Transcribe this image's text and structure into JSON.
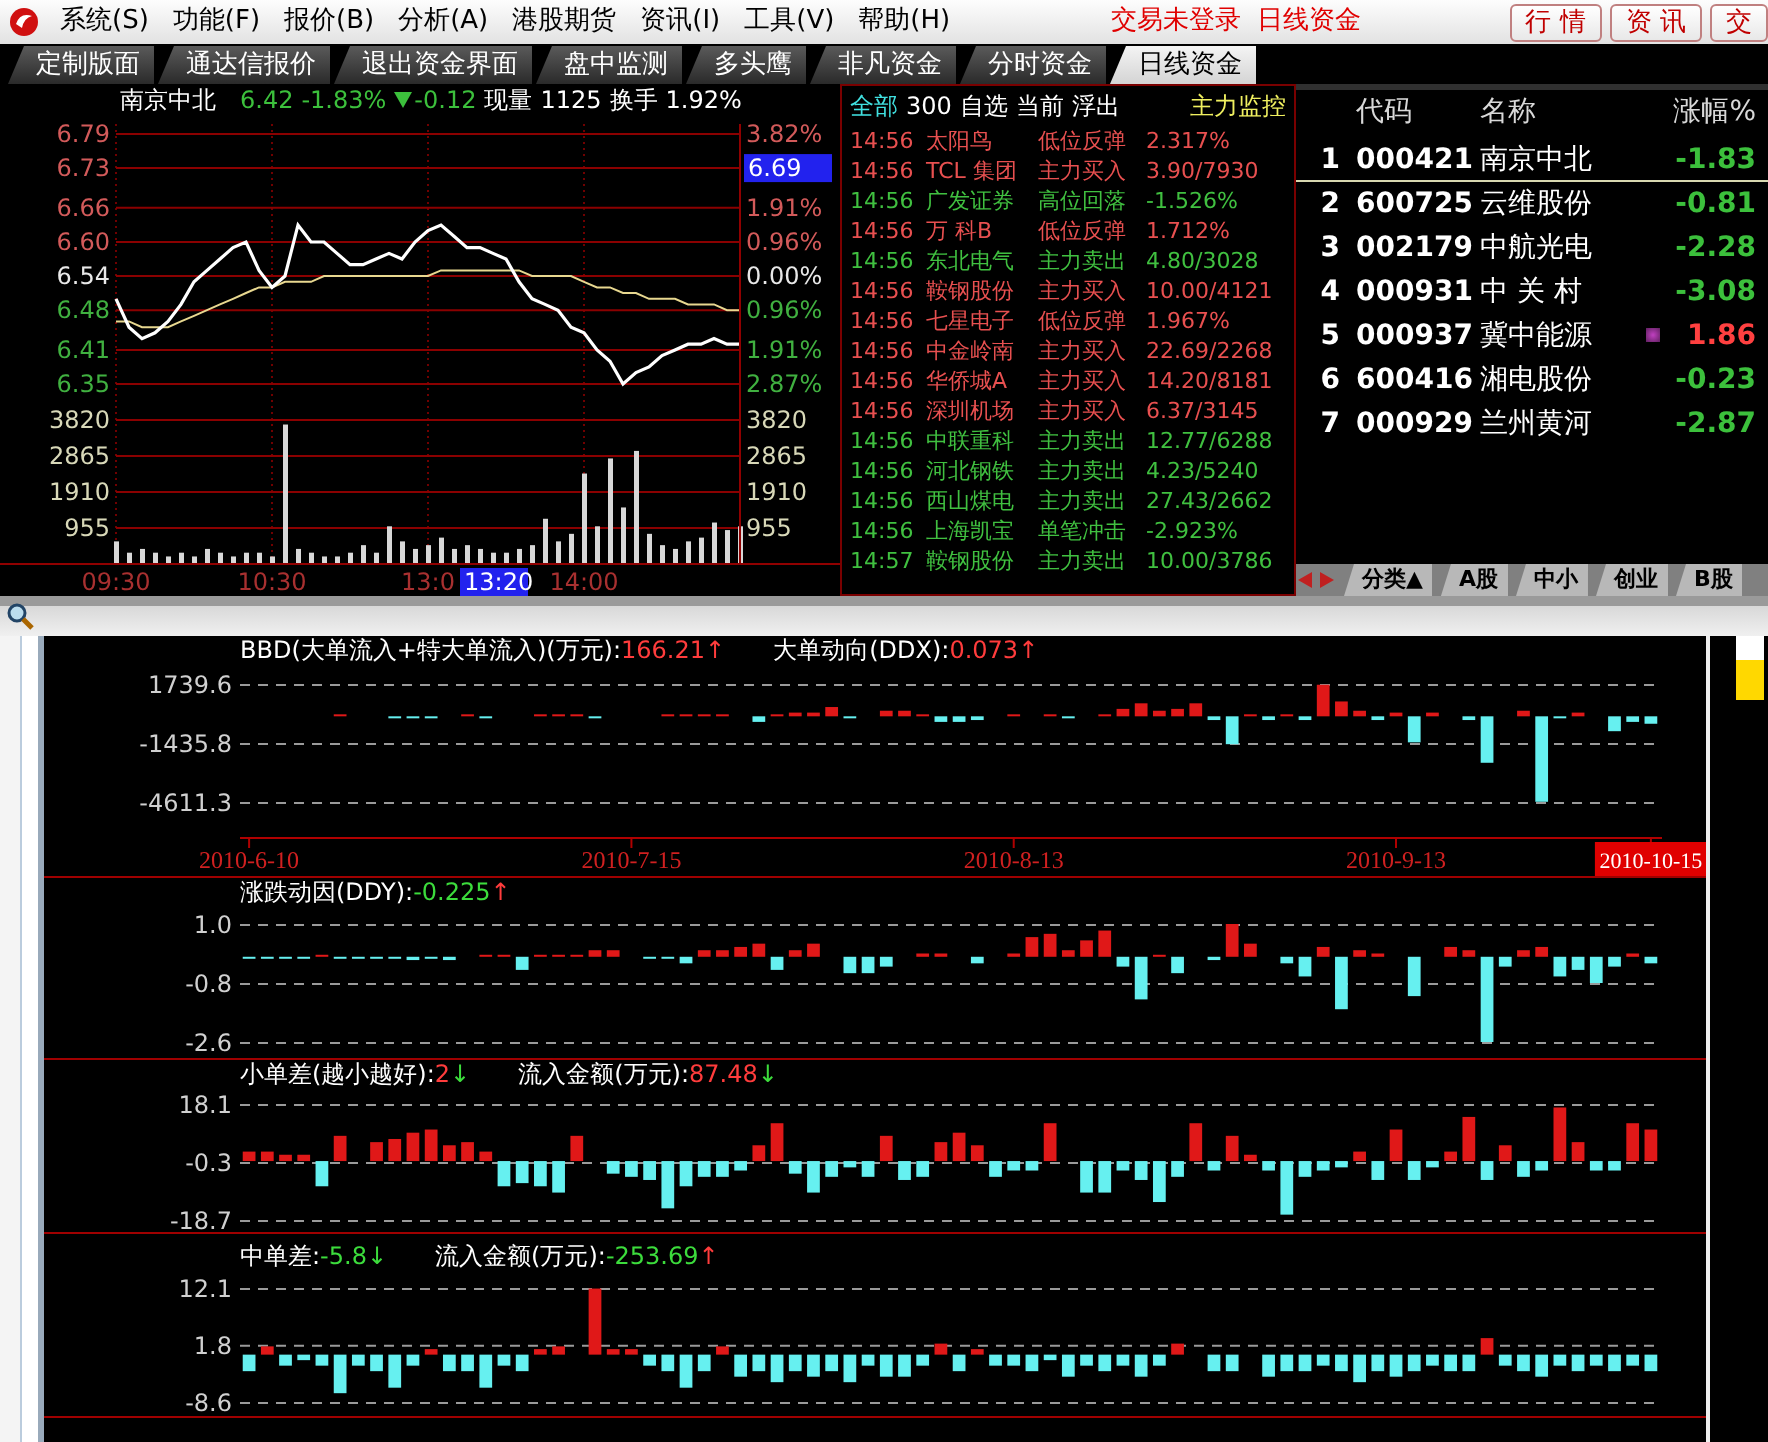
{
  "menu_bar": {
    "items": [
      "系统(S)",
      "功能(F)",
      "报价(B)",
      "分析(A)",
      "港股期货",
      "资讯(I)",
      "工具(V)",
      "帮助(H)"
    ],
    "status": [
      "交易未登录",
      "日线资金"
    ],
    "buttons": [
      "行 情",
      "资 讯",
      "交"
    ]
  },
  "tabs": [
    {
      "label": "定制版面",
      "selected": false
    },
    {
      "label": "通达信报价",
      "selected": false
    },
    {
      "label": "退出资金界面",
      "selected": false
    },
    {
      "label": "盘中监测",
      "selected": false
    },
    {
      "label": "多头鹰",
      "selected": false
    },
    {
      "label": "非凡资金",
      "selected": false
    },
    {
      "label": "分时资金",
      "selected": false
    },
    {
      "label": "日线资金",
      "selected": true
    }
  ],
  "intraday": {
    "header": {
      "name": "南京中北",
      "price": "6.42",
      "change_pct": "-1.83%",
      "change": "-0.12",
      "volume_label": "现量",
      "volume": "1125",
      "turnover_label": "换手",
      "turnover": "1.92%"
    },
    "chart_data": {
      "type": "line",
      "grid": true,
      "ylim": [
        6.35,
        6.79
      ],
      "yticks": [
        {
          "value": 6.79,
          "label": "6.79"
        },
        {
          "value": 6.73,
          "label": "6.73"
        },
        {
          "value": 6.66,
          "label": "6.66"
        },
        {
          "value": 6.6,
          "label": "6.60"
        },
        {
          "value": 6.54,
          "label": "6.54"
        },
        {
          "value": 6.48,
          "label": "6.48"
        },
        {
          "value": 6.41,
          "label": "6.41"
        },
        {
          "value": 6.35,
          "label": "6.35"
        }
      ],
      "series": [
        {
          "color": "#ffffff",
          "values": [
            6.5,
            6.45,
            6.43,
            6.44,
            6.46,
            6.49,
            6.53,
            6.55,
            6.57,
            6.59,
            6.6,
            6.55,
            6.52,
            6.54,
            6.63,
            6.6,
            6.6,
            6.58,
            6.56,
            6.56,
            6.57,
            6.58,
            6.57,
            6.6,
            6.62,
            6.63,
            6.61,
            6.59,
            6.59,
            6.58,
            6.57,
            6.53,
            6.5,
            6.49,
            6.48,
            6.45,
            6.44,
            6.41,
            6.39,
            6.35,
            6.37,
            6.38,
            6.4,
            6.41,
            6.42,
            6.42,
            6.43,
            6.42,
            6.42
          ]
        },
        {
          "color": "#e8d890",
          "values": [
            6.46,
            6.46,
            6.45,
            6.45,
            6.45,
            6.46,
            6.47,
            6.48,
            6.49,
            6.5,
            6.51,
            6.52,
            6.52,
            6.53,
            6.53,
            6.53,
            6.54,
            6.54,
            6.54,
            6.54,
            6.54,
            6.54,
            6.54,
            6.54,
            6.54,
            6.55,
            6.55,
            6.55,
            6.55,
            6.55,
            6.55,
            6.55,
            6.54,
            6.54,
            6.54,
            6.54,
            6.53,
            6.52,
            6.52,
            6.51,
            6.51,
            6.5,
            6.5,
            6.5,
            6.49,
            6.49,
            6.49,
            6.48,
            6.48
          ]
        }
      ]
    },
    "right_ticks": [
      {
        "label": "3.82%",
        "kind": "up"
      },
      {
        "label": "6.69",
        "kind": "cursor"
      },
      {
        "label": "1.91%",
        "kind": "up"
      },
      {
        "label": "0.96%",
        "kind": "up"
      },
      {
        "label": "0.00%",
        "kind": "flat"
      },
      {
        "label": "0.96%",
        "kind": "down"
      },
      {
        "label": "1.91%",
        "kind": "down"
      },
      {
        "label": "2.87%",
        "kind": "down"
      }
    ],
    "volume": {
      "chart_data": {
        "type": "bar",
        "grid": true,
        "ylim": [
          0,
          3820
        ],
        "categories": [
          "09:30",
          null,
          null,
          null,
          null,
          null,
          null,
          null,
          null,
          null,
          null,
          null,
          "10:30",
          null,
          null,
          null,
          null,
          null,
          null,
          null,
          null,
          null,
          null,
          null,
          "13:0",
          null,
          null,
          null,
          null,
          null,
          null,
          null,
          null,
          null,
          null,
          null,
          "14:00",
          null,
          null,
          null,
          null,
          null,
          null,
          null,
          null,
          null,
          null,
          null,
          null
        ],
        "yticks": [
          {
            "value": 3820,
            "label": "3820"
          },
          {
            "value": 2865,
            "label": "2865"
          },
          {
            "value": 1910,
            "label": "1910"
          },
          {
            "value": 955,
            "label": "955"
          }
        ],
        "series": [
          {
            "color": "#d8d8d8",
            "values": [
              600,
              300,
              400,
              300,
              200,
              300,
              200,
              400,
              300,
              200,
              300,
              300,
              200,
              3700,
              400,
              300,
              200,
              200,
              300,
              500,
              300,
              1000,
              600,
              400,
              500,
              700,
              400,
              500,
              400,
              300,
              300,
              400,
              500,
              1200,
              600,
              800,
              2400,
              1000,
              2800,
              1500,
              3000,
              800,
              500,
              400,
              600,
              700,
              1100,
              900,
              1000
            ]
          }
        ]
      },
      "right_ticks": [
        "3820",
        "2865",
        "1910",
        "955"
      ]
    },
    "time_cursor": "13:20"
  },
  "monitor": {
    "filters": [
      {
        "label": "全部",
        "selected": true
      },
      {
        "label": "300",
        "selected": false
      },
      {
        "label": "自选",
        "selected": false
      },
      {
        "label": "当前",
        "selected": false
      },
      {
        "label": "浮出",
        "selected": false
      }
    ],
    "title": "主力监控",
    "rows": [
      {
        "time": "14:56",
        "name": "太阳鸟",
        "signal": "低位反弹",
        "value": "2.317%",
        "color": "#e85050"
      },
      {
        "time": "14:56",
        "name": "TCL 集团",
        "signal": "主力买入",
        "value": "3.90/7930",
        "color": "#e85050"
      },
      {
        "time": "14:56",
        "name": "广发证券",
        "signal": "高位回落",
        "value": "-1.526%",
        "color": "#40c040"
      },
      {
        "time": "14:56",
        "name": "万 科B",
        "signal": "低位反弹",
        "value": "1.712%",
        "color": "#e85050"
      },
      {
        "time": "14:56",
        "name": "东北电气",
        "signal": "主力卖出",
        "value": "4.80/3028",
        "color": "#40c040"
      },
      {
        "time": "14:56",
        "name": "鞍钢股份",
        "signal": "主力买入",
        "value": "10.00/4121",
        "color": "#e85050"
      },
      {
        "time": "14:56",
        "name": "七星电子",
        "signal": "低位反弹",
        "value": "1.967%",
        "color": "#e85050"
      },
      {
        "time": "14:56",
        "name": "中金岭南",
        "signal": "主力买入",
        "value": "22.69/2268",
        "color": "#e85050"
      },
      {
        "time": "14:56",
        "name": "华侨城A",
        "signal": "主力买入",
        "value": "14.20/8181",
        "color": "#e85050"
      },
      {
        "time": "14:56",
        "name": "深圳机场",
        "signal": "主力买入",
        "value": "6.37/3145",
        "color": "#e85050"
      },
      {
        "time": "14:56",
        "name": "中联重科",
        "signal": "主力卖出",
        "value": "12.77/6288",
        "color": "#40c040"
      },
      {
        "time": "14:56",
        "name": "河北钢铁",
        "signal": "主力卖出",
        "value": "4.23/5240",
        "color": "#40c040"
      },
      {
        "time": "14:56",
        "name": "西山煤电",
        "signal": "主力卖出",
        "value": "27.43/2662",
        "color": "#40c040"
      },
      {
        "time": "14:56",
        "name": "上海凯宝",
        "signal": "单笔冲击",
        "value": "-2.923%",
        "color": "#40c040"
      },
      {
        "time": "14:57",
        "name": "鞍钢股份",
        "signal": "主力卖出",
        "value": "10.00/3786",
        "color": "#40c040"
      }
    ]
  },
  "quotes": {
    "columns": [
      "代码",
      "名称",
      "涨幅%"
    ],
    "rows": [
      {
        "num": "1",
        "code": "000421",
        "name": "南京中北",
        "change": "-1.83",
        "color": "#3cc03c",
        "selected": true,
        "flagged": false
      },
      {
        "num": "2",
        "code": "600725",
        "name": "云维股份",
        "change": "-0.81",
        "color": "#3cc03c",
        "selected": false,
        "flagged": false
      },
      {
        "num": "3",
        "code": "002179",
        "name": "中航光电",
        "change": "-2.28",
        "color": "#3cc03c",
        "selected": false,
        "flagged": false
      },
      {
        "num": "4",
        "code": "000931",
        "name": "中 关 村",
        "change": "-3.08",
        "color": "#3cc03c",
        "selected": false,
        "flagged": false
      },
      {
        "num": "5",
        "code": "000937",
        "name": "冀中能源",
        "change": "1.86",
        "color": "#ff4040",
        "selected": false,
        "flagged": true
      },
      {
        "num": "6",
        "code": "600416",
        "name": "湘电股份",
        "change": "-0.23",
        "color": "#3cc03c",
        "selected": false,
        "flagged": false
      },
      {
        "num": "7",
        "code": "000929",
        "name": "兰州黄河",
        "change": "-2.87",
        "color": "#3cc03c",
        "selected": false,
        "flagged": false
      }
    ],
    "tabs": [
      "分类▲",
      "A股",
      "中小",
      "创业",
      "B股"
    ]
  },
  "panels": [
    {
      "indicators": [
        {
          "label": "BBD(大单流入+特大单流入)(万元):",
          "value": {
            "text": "166.21",
            "color": "#ff3c3c"
          },
          "arrow": {
            "text": "↑",
            "color": "#ff3c3c"
          }
        },
        {
          "label": "大单动向(DDX):",
          "value": {
            "text": "0.073",
            "color": "#ff3c3c"
          },
          "arrow": {
            "text": "↑",
            "color": "#ff3c3c"
          }
        }
      ],
      "date_marks": [
        {
          "selected": false
        },
        {
          "selected": false
        },
        {
          "selected": false
        },
        {
          "selected": false
        },
        {
          "selected": true
        }
      ],
      "chart_data": {
        "type": "bar",
        "ylim": [
          -4611.3,
          1739.6
        ],
        "yticks": [
          {
            "value": 1739.6,
            "label": "1739.6"
          },
          {
            "value": -1435.8,
            "label": "-1435.8"
          },
          {
            "value": -4611.3,
            "label": "-4611.3"
          }
        ],
        "categories": [
          "2010-6-10",
          null,
          null,
          null,
          null,
          null,
          null,
          null,
          null,
          null,
          null,
          null,
          null,
          null,
          null,
          null,
          null,
          null,
          null,
          null,
          null,
          "2010-7-15",
          null,
          null,
          null,
          null,
          null,
          null,
          null,
          null,
          null,
          null,
          null,
          null,
          null,
          null,
          null,
          null,
          null,
          null,
          null,
          null,
          "2010-8-13",
          null,
          null,
          null,
          null,
          null,
          null,
          null,
          null,
          null,
          null,
          null,
          null,
          null,
          null,
          null,
          null,
          null,
          null,
          null,
          null,
          "2010-9-13",
          null,
          null,
          null,
          null,
          null,
          null,
          null,
          null,
          null,
          null,
          null,
          null,
          null,
          "2010-10-15"
        ],
        "values": [
          0,
          0,
          0,
          0,
          0,
          100,
          0,
          0,
          -100,
          -100,
          -100,
          0,
          100,
          -100,
          0,
          0,
          100,
          100,
          100,
          -100,
          0,
          0,
          0,
          100,
          100,
          100,
          100,
          0,
          -300,
          100,
          200,
          200,
          500,
          -100,
          0,
          300,
          300,
          100,
          -300,
          -300,
          -200,
          0,
          100,
          0,
          100,
          -100,
          0,
          100,
          400,
          700,
          300,
          400,
          700,
          -200,
          -1500,
          100,
          -200,
          100,
          -200,
          1700,
          800,
          300,
          -200,
          200,
          -1400,
          200,
          0,
          -200,
          -2500,
          0,
          300,
          -4600,
          -100,
          200,
          0,
          -800,
          -300,
          -400
        ]
      }
    },
    {
      "indicators": [
        {
          "label": "涨跌动因(DDY):",
          "value": {
            "text": "-0.225",
            "color": "#3cdc3c"
          },
          "arrow": {
            "text": "↑",
            "color": "#ff3c3c"
          }
        }
      ],
      "chart_data": {
        "type": "bar",
        "ylim": [
          -2.6,
          1.0
        ],
        "yticks": [
          {
            "value": 1.0,
            "label": "1.0"
          },
          {
            "value": -0.8,
            "label": "-0.8"
          },
          {
            "value": -2.6,
            "label": "-2.6"
          }
        ],
        "values": [
          -0.05,
          -0.05,
          -0.05,
          -0.05,
          0.05,
          -0.05,
          -0.05,
          -0.05,
          -0.05,
          -0.1,
          -0.05,
          -0.1,
          0,
          0.05,
          0.05,
          -0.4,
          0.05,
          0.05,
          0.05,
          0.2,
          0.2,
          0,
          -0.05,
          -0.05,
          -0.2,
          0.2,
          0.2,
          0.3,
          0.4,
          -0.4,
          0.2,
          0.4,
          0,
          -0.5,
          -0.5,
          -0.3,
          0,
          0.1,
          0.1,
          0,
          -0.2,
          0,
          0.1,
          0.6,
          0.7,
          0.2,
          0.5,
          0.8,
          -0.3,
          -1.3,
          0.05,
          -0.5,
          0,
          -0.1,
          1.0,
          0.4,
          0,
          -0.2,
          -0.6,
          0.3,
          -1.6,
          0.2,
          0.1,
          0,
          -1.2,
          0,
          0.3,
          0.2,
          -2.6,
          -0.3,
          0.2,
          0.3,
          -0.6,
          -0.4,
          -0.8,
          -0.3,
          0.1,
          -0.2
        ]
      }
    },
    {
      "indicators": [
        {
          "label": "小单差(越小越好):",
          "value": {
            "text": "2",
            "color": "#ff3c3c"
          },
          "arrow": {
            "text": "↓",
            "color": "#3cdc3c"
          }
        },
        {
          "label": "流入金额(万元):",
          "value": {
            "text": "87.48",
            "color": "#ff3c3c"
          },
          "arrow": {
            "text": "↓",
            "color": "#3cdc3c"
          }
        }
      ],
      "chart_data": {
        "type": "bar",
        "ylim": [
          -18.7,
          18.1
        ],
        "yticks": [
          {
            "value": 18.1,
            "label": "18.1"
          },
          {
            "value": -0.3,
            "label": "-0.3"
          },
          {
            "value": -18.7,
            "label": "-18.7"
          }
        ],
        "values": [
          3,
          3,
          2,
          2,
          -8,
          8,
          0,
          6,
          7,
          9,
          10,
          5,
          6,
          3,
          -8,
          -7,
          -8,
          -10,
          8,
          0,
          -4,
          -5,
          -6,
          -15,
          -8,
          -5,
          -5,
          -3,
          5,
          12,
          -4,
          -10,
          -5,
          -2,
          -5,
          8,
          -6,
          -5,
          6,
          9,
          5,
          -5,
          -3,
          -3,
          12,
          0,
          -10,
          -10,
          -3,
          -6,
          -13,
          -5,
          12,
          -3,
          8,
          2,
          -3,
          -17,
          -5,
          -3,
          -2,
          3,
          -6,
          10,
          -6,
          -2,
          3,
          14,
          -6,
          5,
          -5,
          -3,
          17,
          6,
          -3,
          -3,
          12,
          10
        ]
      }
    },
    {
      "indicators": [
        {
          "label": "中单差:",
          "value": {
            "text": "-5.8",
            "color": "#3cdc3c"
          },
          "arrow": {
            "text": "↓",
            "color": "#3cdc3c"
          }
        },
        {
          "label": "流入金额(万元):",
          "value": {
            "text": "-253.69",
            "color": "#3cdc3c"
          },
          "arrow": {
            "text": "↑",
            "color": "#ff3c3c"
          }
        }
      ],
      "chart_data": {
        "type": "bar",
        "ylim": [
          -8.6,
          12.1
        ],
        "yticks": [
          {
            "value": 12.1,
            "label": "12.1"
          },
          {
            "value": 1.8,
            "label": "1.8"
          },
          {
            "value": -8.6,
            "label": "-8.6"
          }
        ],
        "values": [
          -3,
          1.5,
          -2,
          -1,
          -2,
          -7,
          -2,
          -3,
          -6,
          -2,
          1,
          -3,
          -3,
          -6,
          -2,
          -3,
          1,
          1.5,
          0,
          12,
          1,
          1,
          -2,
          -3,
          -6,
          -3,
          1.5,
          -4,
          -3,
          -5,
          -3,
          -4,
          -3,
          -5,
          -2,
          -4,
          -4,
          -2,
          2,
          -3,
          1,
          -2,
          -2,
          -3,
          -1,
          -4,
          -2,
          -3,
          -2,
          -4,
          -2,
          2,
          0,
          -3,
          -3,
          0,
          -4,
          -3,
          -3,
          -2,
          -3,
          -5,
          -3,
          -4,
          -3,
          -2,
          -3,
          -3,
          3,
          -2,
          -3,
          -4,
          -2,
          -3,
          -2,
          -3,
          -2,
          -3
        ]
      }
    }
  ]
}
